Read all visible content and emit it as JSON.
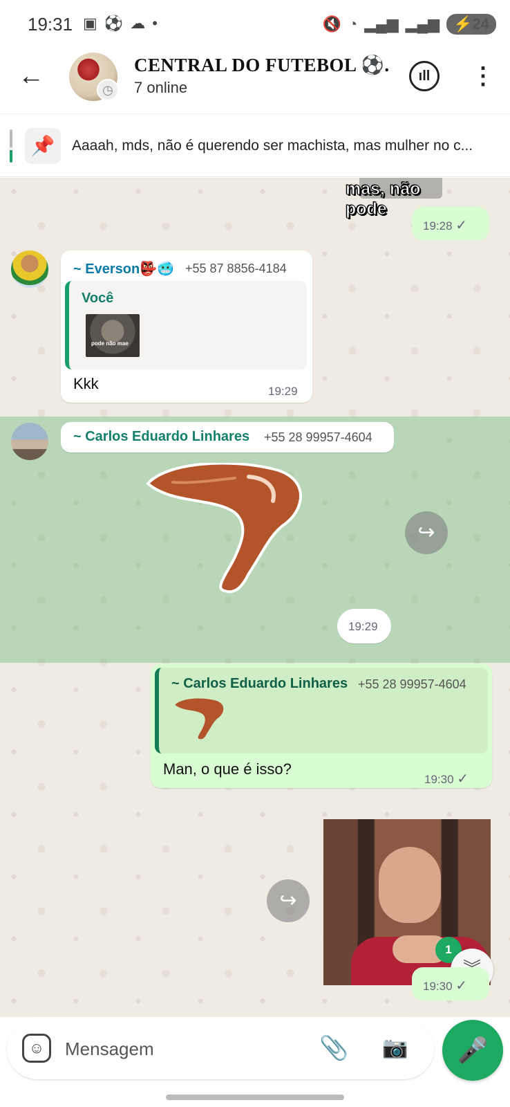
{
  "status_bar": {
    "time": "19:31",
    "battery": "24"
  },
  "header": {
    "title": "CENTRAL DO FUTEBOL ⚽...",
    "subtitle": "7 online"
  },
  "pinned": {
    "text": "Aaaah, mds, não é querendo ser machista, mas mulher no c..."
  },
  "messages": [
    {
      "type": "sticker-out",
      "caption": "mas, não pode",
      "time": "19:28"
    },
    {
      "type": "reply-in",
      "sender": "~ Everson👺🥶",
      "phone": "+55 87 8856-4184",
      "quote_author": "Você",
      "quote_image_caption": "pode não mae",
      "text": "Kkk",
      "time": "19:29"
    },
    {
      "type": "sticker-in",
      "sender": "~ Carlos Eduardo Linhares",
      "phone": "+55 28 99957-4604",
      "time": "19:29"
    },
    {
      "type": "reply-out",
      "quote_author": "~ Carlos Eduardo Linhares",
      "quote_phone": "+55 28 99957-4604",
      "text": "Man, o que é isso?",
      "time": "19:30"
    },
    {
      "type": "image-out",
      "time": "19:30"
    }
  ],
  "unread_badge": "1",
  "input": {
    "placeholder": "Mensagem"
  },
  "colors": {
    "accent": "#1da962",
    "bubble_out": "#d9fdd3",
    "sender_everson": "#0b7aa6",
    "sender_carlos": "#13806b"
  }
}
